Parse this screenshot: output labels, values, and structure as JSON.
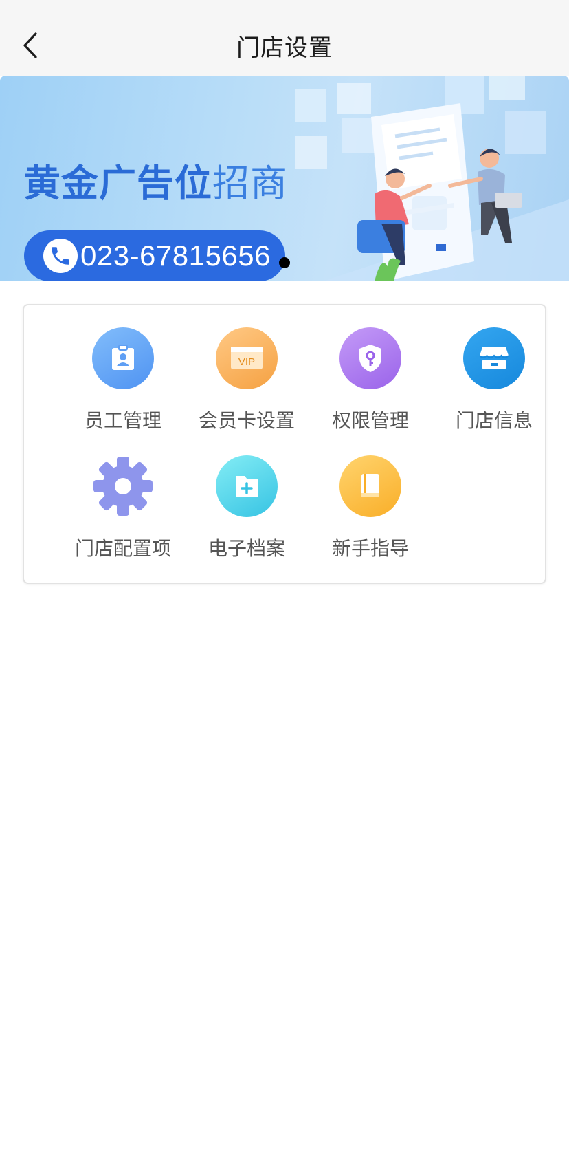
{
  "header": {
    "title": "门店设置",
    "back_icon": "chevron-left-icon"
  },
  "banner": {
    "headline_bold": "黄金广告位",
    "headline_light": "招商",
    "phone": "023-67815656",
    "phone_icon": "phone-icon"
  },
  "menu": {
    "items": [
      {
        "label": "员工管理",
        "icon": "id-badge-icon"
      },
      {
        "label": "会员卡设置",
        "icon": "vip-card-icon"
      },
      {
        "label": "权限管理",
        "icon": "shield-key-icon"
      },
      {
        "label": "门店信息",
        "icon": "store-icon"
      },
      {
        "label": "门店配置项",
        "icon": "gear-icon"
      },
      {
        "label": "电子档案",
        "icon": "folder-plus-icon"
      },
      {
        "label": "新手指导",
        "icon": "book-icon"
      }
    ]
  },
  "colors": {
    "header_bg": "#f6f6f6",
    "banner_accent": "#2b6ae0",
    "label_text": "#555555"
  }
}
